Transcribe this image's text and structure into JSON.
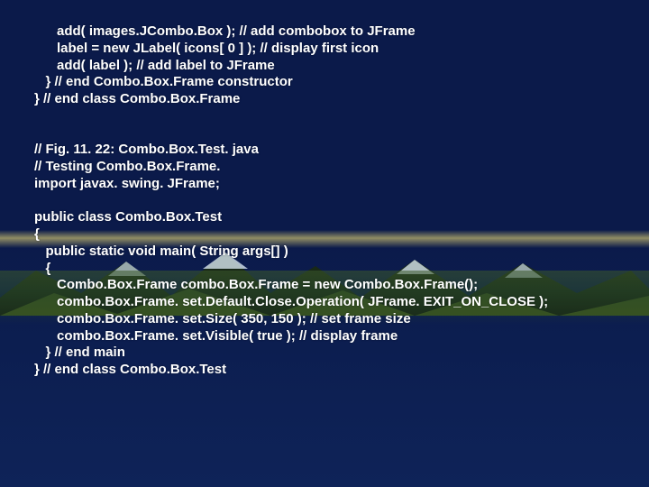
{
  "code": {
    "l1": "      add( images.JCombo.Box ); // add combobox to JFrame",
    "l2": "      label = new JLabel( icons[ 0 ] ); // display first icon",
    "l3": "      add( label ); // add label to JFrame",
    "l4": "   } // end Combo.Box.Frame constructor",
    "l5": "} // end class Combo.Box.Frame",
    "l6": "",
    "l7": "",
    "l8": "// Fig. 11. 22: Combo.Box.Test. java",
    "l9": "// Testing Combo.Box.Frame.",
    "l10": "import javax. swing. JFrame;",
    "l11": "",
    "l12": "public class Combo.Box.Test",
    "l13": "{",
    "l14": "   public static void main( String args[] )",
    "l15": "   {",
    "l16": "      Combo.Box.Frame combo.Box.Frame = new Combo.Box.Frame();",
    "l17": "      combo.Box.Frame. set.Default.Close.Operation( JFrame. EXIT_ON_CLOSE );",
    "l18": "      combo.Box.Frame. set.Size( 350, 150 ); // set frame size",
    "l19": "      combo.Box.Frame. set.Visible( true ); // display frame",
    "l20": "   } // end main",
    "l21": "} // end class Combo.Box.Test"
  }
}
